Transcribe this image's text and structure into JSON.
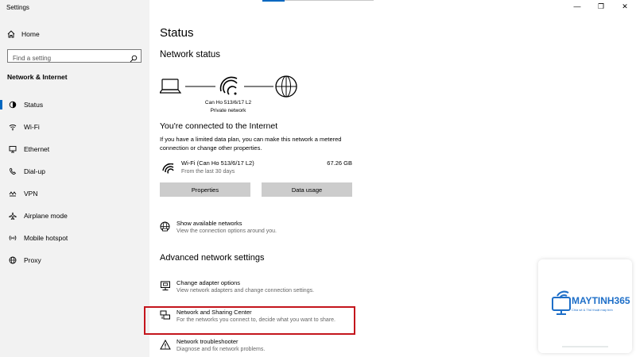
{
  "window": {
    "title": "Settings",
    "controls": {
      "minimize": "—",
      "maximize": "❐",
      "close": "✕"
    }
  },
  "sidebar": {
    "home_label": "Home",
    "search_placeholder": "Find a setting",
    "section_title": "Network & Internet",
    "items": [
      {
        "label": "Status",
        "icon": "status-icon",
        "active": true
      },
      {
        "label": "Wi-Fi",
        "icon": "wifi-icon",
        "active": false
      },
      {
        "label": "Ethernet",
        "icon": "ethernet-icon",
        "active": false
      },
      {
        "label": "Dial-up",
        "icon": "dialup-icon",
        "active": false
      },
      {
        "label": "VPN",
        "icon": "vpn-icon",
        "active": false
      },
      {
        "label": "Airplane mode",
        "icon": "airplane-icon",
        "active": false
      },
      {
        "label": "Mobile hotspot",
        "icon": "hotspot-icon",
        "active": false
      },
      {
        "label": "Proxy",
        "icon": "globe-icon",
        "active": false
      }
    ]
  },
  "main": {
    "title": "Status",
    "network_status_heading": "Network status",
    "diagram": {
      "network_name": "Can Ho 513/6/17 L2",
      "network_type": "Private network"
    },
    "connected_heading": "You're connected to the Internet",
    "connected_desc": "If you have a limited data plan, you can make this network a metered connection or change other properties.",
    "connection": {
      "name": "Wi-Fi (Can Ho 513/6/17 L2)",
      "sub": "From the last 30 days",
      "usage": "67.26 GB"
    },
    "buttons": {
      "properties": "Properties",
      "data_usage": "Data usage"
    },
    "show_networks": {
      "title": "Show available networks",
      "desc": "View the connection options around you."
    },
    "advanced_heading": "Advanced network settings",
    "adapter": {
      "title": "Change adapter options",
      "desc": "View network adapters and change connection settings."
    },
    "sharing": {
      "title": "Network and Sharing Center",
      "desc": "For the networks you connect to, decide what you want to share."
    },
    "troubleshooter": {
      "title": "Network troubleshooter",
      "desc": "Diagnose and fix network problems."
    }
  },
  "colors": {
    "accent": "#0067c0",
    "highlight_border": "#c4151c",
    "sidebar_bg": "#f2f2f2",
    "button_bg": "#cccccc",
    "logo_blue": "#1e6fc8"
  }
}
